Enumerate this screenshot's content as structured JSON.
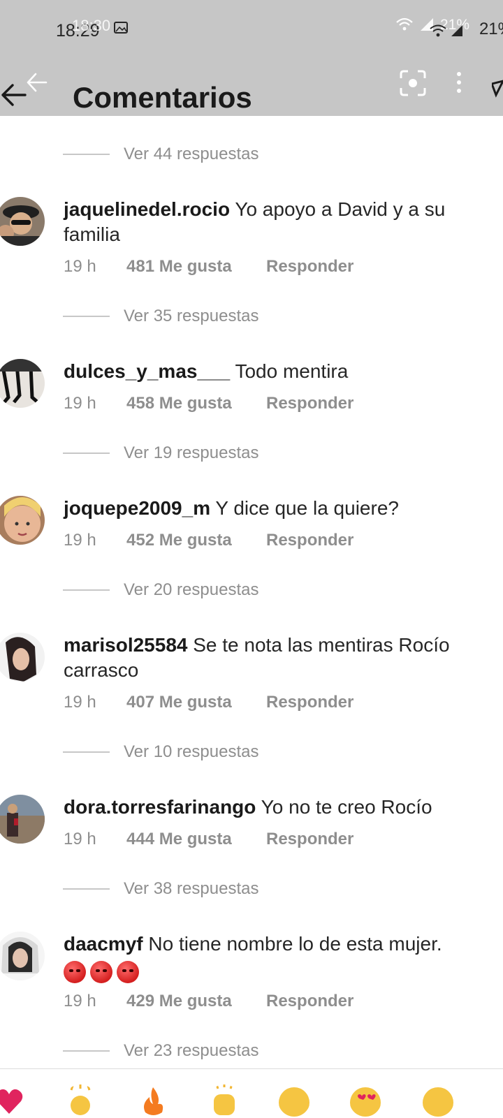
{
  "status": {
    "time_primary": "18:29",
    "time_overlay": "18:30",
    "battery_primary": "21%",
    "battery_overlay": "21%"
  },
  "header": {
    "title": "Comentarios"
  },
  "threads": [
    {
      "label": "Ver 44 respuestas"
    },
    {
      "label": "Ver 35 respuestas"
    },
    {
      "label": "Ver 19 respuestas"
    },
    {
      "label": "Ver 20 respuestas"
    },
    {
      "label": "Ver 10 respuestas"
    },
    {
      "label": "Ver 38 respuestas"
    },
    {
      "label": "Ver 23 respuestas"
    }
  ],
  "comments": [
    {
      "username": "jaquelinedel.rocio",
      "text": "Yo apoyo a David y a su familia",
      "time": "19 h",
      "likes": "481 Me gusta",
      "reply": "Responder",
      "avatar_color": "#6b5a4a"
    },
    {
      "username": "dulces_y_mas___",
      "text": "Todo mentira",
      "time": "19 h",
      "likes": "458 Me gusta",
      "reply": "Responder",
      "avatar_color": "#2b2b2b"
    },
    {
      "username": "joquepe2009_m",
      "text": "Y dice que la quiere?",
      "time": "19 h",
      "likes": "452 Me gusta",
      "reply": "Responder",
      "avatar_color": "#c89a78"
    },
    {
      "username": "marisol25584",
      "text": "Se te nota las mentiras Rocío carrasco",
      "time": "19 h",
      "likes": "407 Me gusta",
      "reply": "Responder",
      "avatar_color": "#d9d9d9"
    },
    {
      "username": "dora.torresfarinango",
      "text": "Yo no te creo Rocío",
      "time": "19 h",
      "likes": "444 Me gusta",
      "reply": "Responder",
      "avatar_color": "#7d6d5e"
    },
    {
      "username": "daacmyf",
      "text": "No tiene nombre lo de esta mujer.",
      "time": "19 h",
      "likes": "429 Me gusta",
      "reply": "Responder",
      "avatar_color": "#e6e6e6"
    }
  ],
  "colors": {
    "header_bg": "#c6c6c6",
    "meta_text": "#8e8e8e",
    "divider": "#c7c7c7"
  }
}
